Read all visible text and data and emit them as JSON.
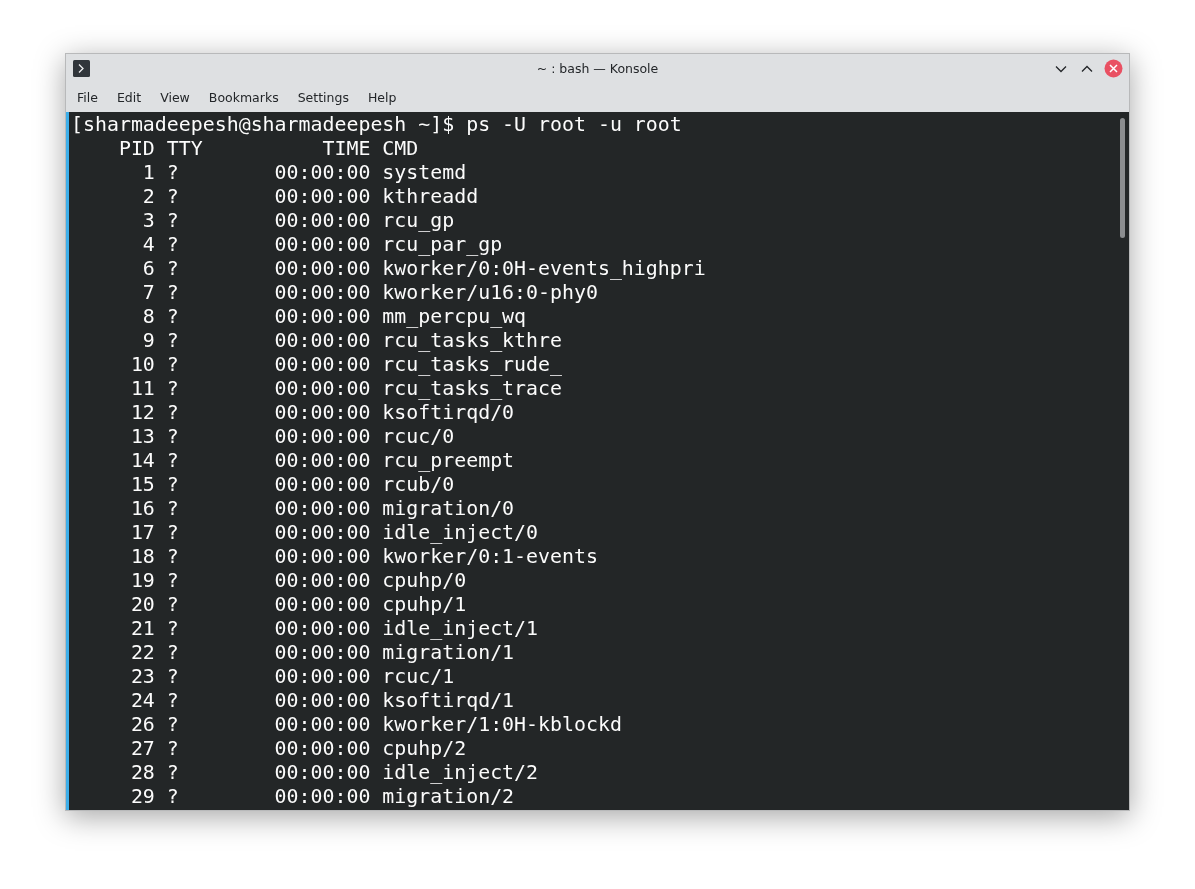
{
  "window": {
    "title": "~ : bash — Konsole"
  },
  "menu": [
    {
      "label": "File"
    },
    {
      "label": "Edit"
    },
    {
      "label": "View"
    },
    {
      "label": "Bookmarks"
    },
    {
      "label": "Settings"
    },
    {
      "label": "Help"
    }
  ],
  "terminal": {
    "lines": [
      "[sharmadeepesh@sharmadeepesh ~]$ ps -U root -u root",
      "    PID TTY          TIME CMD",
      "      1 ?        00:00:00 systemd",
      "      2 ?        00:00:00 kthreadd",
      "      3 ?        00:00:00 rcu_gp",
      "      4 ?        00:00:00 rcu_par_gp",
      "      6 ?        00:00:00 kworker/0:0H-events_highpri",
      "      7 ?        00:00:00 kworker/u16:0-phy0",
      "      8 ?        00:00:00 mm_percpu_wq",
      "      9 ?        00:00:00 rcu_tasks_kthre",
      "     10 ?        00:00:00 rcu_tasks_rude_",
      "     11 ?        00:00:00 rcu_tasks_trace",
      "     12 ?        00:00:00 ksoftirqd/0",
      "     13 ?        00:00:00 rcuc/0",
      "     14 ?        00:00:00 rcu_preempt",
      "     15 ?        00:00:00 rcub/0",
      "     16 ?        00:00:00 migration/0",
      "     17 ?        00:00:00 idle_inject/0",
      "     18 ?        00:00:00 kworker/0:1-events",
      "     19 ?        00:00:00 cpuhp/0",
      "     20 ?        00:00:00 cpuhp/1",
      "     21 ?        00:00:00 idle_inject/1",
      "     22 ?        00:00:00 migration/1",
      "     23 ?        00:00:00 rcuc/1",
      "     24 ?        00:00:00 ksoftirqd/1",
      "     26 ?        00:00:00 kworker/1:0H-kblockd",
      "     27 ?        00:00:00 cpuhp/2",
      "     28 ?        00:00:00 idle_inject/2",
      "     29 ?        00:00:00 migration/2"
    ]
  }
}
